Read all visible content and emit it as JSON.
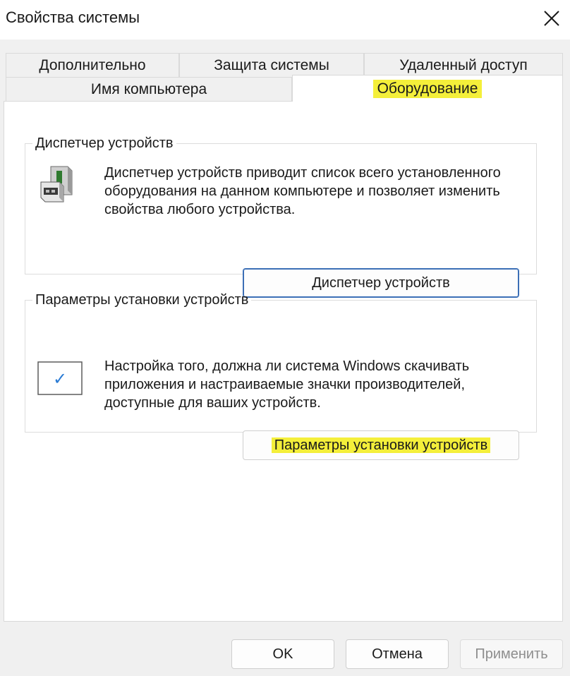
{
  "window": {
    "title": "Свойства системы",
    "close_glyph": "✕"
  },
  "tabs": {
    "row1": [
      {
        "label": "Дополнительно"
      },
      {
        "label": "Защита системы"
      },
      {
        "label": "Удаленный доступ"
      }
    ],
    "row2": [
      {
        "label": "Имя компьютера"
      },
      {
        "label": "Оборудование",
        "selected": true
      }
    ]
  },
  "device_manager": {
    "legend": "Диспетчер устройств",
    "icon": "device-manager-icon",
    "description": "Диспетчер устройств приводит список всего установленного оборудования на данном компьютере и позволяет изменить свойства любого устройства.",
    "button_label": "Диспетчер устройств"
  },
  "install_settings": {
    "legend": "Параметры установки устройств",
    "icon": "checkbox-icon",
    "check_glyph": "✓",
    "description": "Настройка того, должна ли система Windows скачивать приложения и настраиваемые значки производителей, доступные для ваших устройств.",
    "button_label": "Параметры установки устройств"
  },
  "footer": {
    "ok_label": "OK",
    "cancel_label": "Отмена",
    "apply_label": "Применить"
  },
  "colors": {
    "highlight": "#f4ef3a",
    "focus_border": "#3c6fb6",
    "check_blue": "#2a7bd4"
  }
}
